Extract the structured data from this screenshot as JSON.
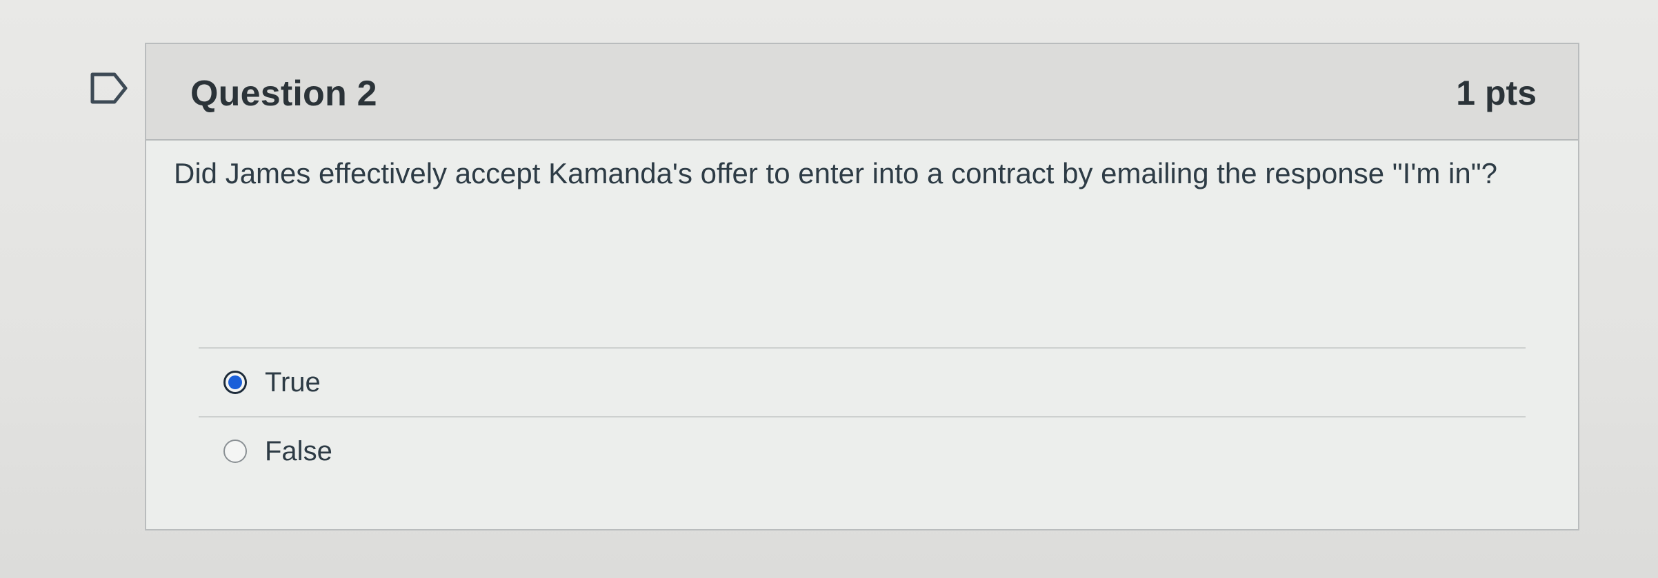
{
  "question": {
    "title": "Question 2",
    "points": "1 pts",
    "text": "Did James effectively accept Kamanda's offer to enter into a contract by emailing the response \"I'm in\"?",
    "flag_icon": "bookmark-flag-icon"
  },
  "answers": [
    {
      "label": "True",
      "selected": true
    },
    {
      "label": "False",
      "selected": false
    }
  ],
  "colors": {
    "selected_radio": "#1a5fd9",
    "header_bg": "#dcdcda",
    "text": "#2d3b45"
  }
}
